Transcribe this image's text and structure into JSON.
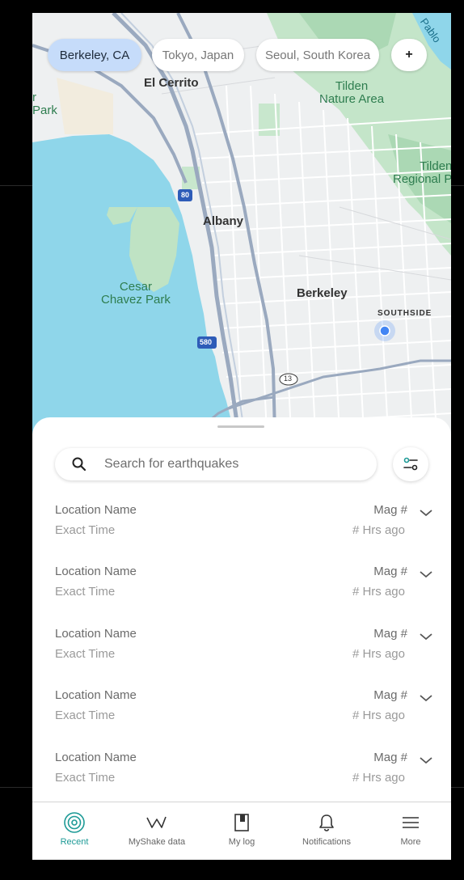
{
  "colors": {
    "accent": "#1c9a96",
    "chip_active_bg": "#c6dcfa",
    "water": "#8fd6ea",
    "park": "#bfe3c4",
    "location_dot": "#4285f4"
  },
  "location_chips": [
    {
      "label": "Berkeley, CA",
      "selected": true
    },
    {
      "label": "Tokyo, Japan",
      "selected": false
    },
    {
      "label": "Seoul, South Korea",
      "selected": false
    }
  ],
  "add_chip_label": "+",
  "map": {
    "labels": {
      "el_cerrito": "El Cerrito",
      "albany": "Albany",
      "berkeley": "Berkeley",
      "southside": "SOUTHSIDE",
      "cesar_chavez_park": "Cesar\nChavez Park",
      "tilden_nature_area": "Tilden\nNature Area",
      "tilden_regional": "Tilden\nRegional P",
      "park_left": "r\nPark",
      "pablo": "Pablo",
      "route_80": "80",
      "route_580": "580",
      "route_13": "13"
    }
  },
  "search": {
    "placeholder": "Search for earthquakes",
    "icon": "search-icon"
  },
  "filter_icon": "filter-icon",
  "earthquakes": [
    {
      "location": "Location Name",
      "time": "Exact Time",
      "magnitude": "Mag #",
      "ago": "# Hrs ago"
    },
    {
      "location": "Location Name",
      "time": "Exact Time",
      "magnitude": "Mag #",
      "ago": "# Hrs ago"
    },
    {
      "location": "Location Name",
      "time": "Exact Time",
      "magnitude": "Mag #",
      "ago": "# Hrs ago"
    },
    {
      "location": "Location Name",
      "time": "Exact Time",
      "magnitude": "Mag #",
      "ago": "# Hrs ago"
    },
    {
      "location": "Location Name",
      "time": "Exact Time",
      "magnitude": "Mag #",
      "ago": "# Hrs ago"
    }
  ],
  "nav": [
    {
      "label": "Recent",
      "icon": "target-icon",
      "active": true
    },
    {
      "label": "MyShake data",
      "icon": "wave-icon",
      "active": false
    },
    {
      "label": "My log",
      "icon": "notebook-icon",
      "active": false
    },
    {
      "label": "Notifications",
      "icon": "bell-icon",
      "active": false
    },
    {
      "label": "More",
      "icon": "menu-icon",
      "active": false
    }
  ]
}
